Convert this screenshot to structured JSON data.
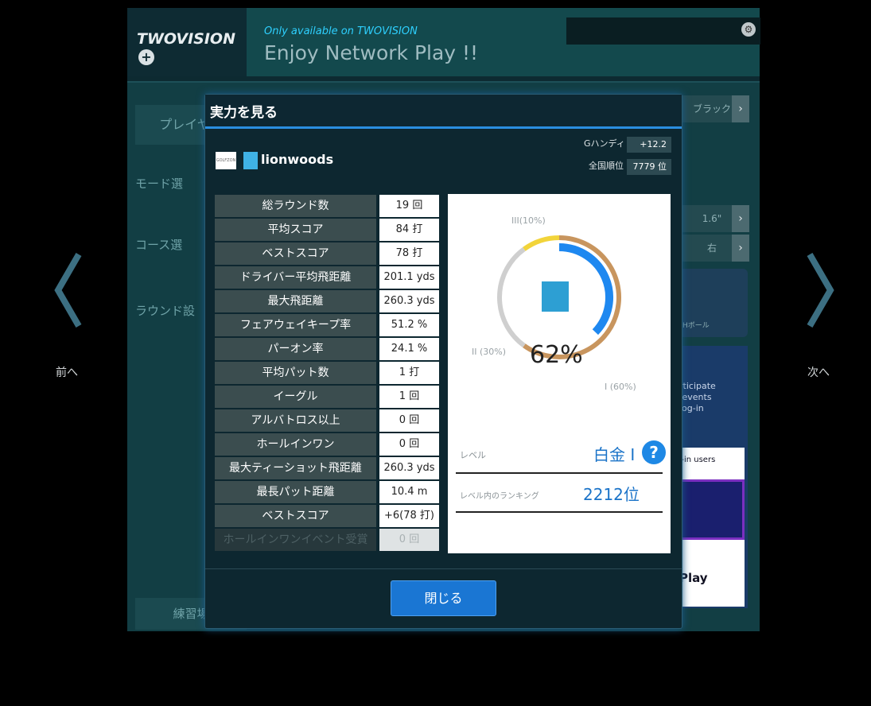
{
  "background": {
    "logo": "TWOVISION",
    "banner_subtitle": "Only available on TWOVISION",
    "banner_title": "Enjoy Network Play !!",
    "side_items": [
      "プレイヤー",
      "モード選",
      "コース選",
      "ラウンド設"
    ],
    "practice_label": "練習場",
    "right_buttons": [
      "ブラック",
      "1.6\"",
      "右"
    ],
    "promo_text": "rticipate\n events\nlog-in",
    "promo_card_label": "d-in users",
    "promo_play": "Play",
    "ball_label": "Hボール"
  },
  "nav": {
    "prev_label": "前へ",
    "next_label": "次へ"
  },
  "modal": {
    "title": "実力を見る",
    "player_name": "lionwoods",
    "logo_text": "GOLFZON",
    "ghandi_label": "Gハンディ",
    "ghandi_value": "+12.2",
    "rank_label": "全国順位",
    "rank_value": "7779 位",
    "stats": [
      {
        "label": "総ラウンド数",
        "value": "19 回"
      },
      {
        "label": "平均スコア",
        "value": "84 打"
      },
      {
        "label": "ベストスコア",
        "value": "78 打"
      },
      {
        "label": "ドライバー平均飛距離",
        "value": "201.1 yds"
      },
      {
        "label": "最大飛距離",
        "value": "260.3 yds"
      },
      {
        "label": "フェアウェイキープ率",
        "value": "51.2 %"
      },
      {
        "label": "パーオン率",
        "value": "24.1 %"
      },
      {
        "label": "平均パット数",
        "value": "1 打"
      },
      {
        "label": "イーグル",
        "value": "1 回"
      },
      {
        "label": "アルバトロス以上",
        "value": "0 回"
      },
      {
        "label": "ホールインワン",
        "value": "0 回"
      },
      {
        "label": "最大ティーショット飛距離",
        "value": "260.3 yds"
      },
      {
        "label": "最長パット距離",
        "value": "10.4 m"
      },
      {
        "label": "ベストスコア",
        "value": "+6(78 打)"
      },
      {
        "label": "ホールインワンイベント受賞",
        "value": "0 回"
      }
    ],
    "ring": {
      "percent_text": "62%",
      "progress": 0.62,
      "label_iii": "III(10%)",
      "label_ii": "II (30%)",
      "label_i": "I (60%)",
      "colors": {
        "iii": "#f2d43a",
        "ii": "#cfcfcf",
        "i": "#c8955e",
        "progress": "#1e88f0"
      }
    },
    "level_label": "レベル",
    "level_value": "白金 I",
    "help_symbol": "?",
    "level_rank_label": "レベル内のランキング",
    "level_rank_value": "2212位",
    "close_label": "閉じる"
  }
}
